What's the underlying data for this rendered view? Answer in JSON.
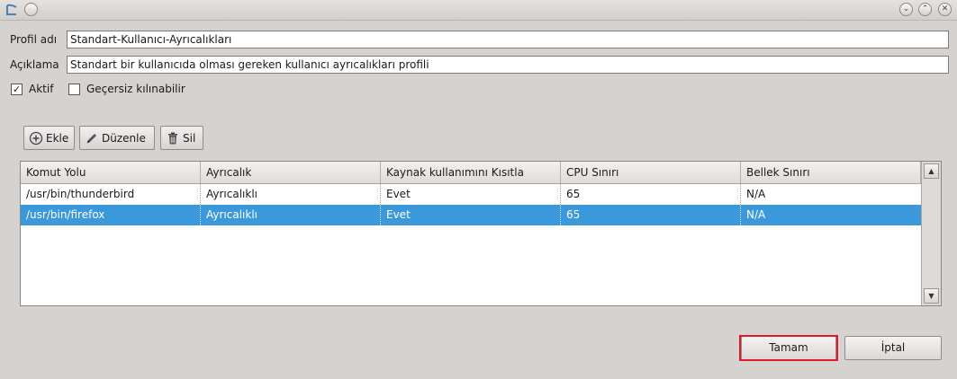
{
  "titlebar": {
    "app_icon": "app-logo-icon",
    "buttons": [
      "minimize-icon",
      "maximize-icon",
      "close-icon"
    ]
  },
  "form": {
    "profile_name_label": "Profil adı",
    "profile_name_value": "Standart-Kullanıcı-Ayrıcalıkları",
    "description_label": "Açıklama",
    "description_value": "Standart bir kullanıcıda olması gereken kullanıcı ayrıcalıkları profili",
    "active_label": "Aktif",
    "active_checked": true,
    "overridable_label": "Geçersiz kılınabilir",
    "overridable_checked": false
  },
  "toolbar": {
    "add_label": "Ekle",
    "edit_label": "Düzenle",
    "delete_label": "Sil"
  },
  "table": {
    "columns": [
      "Komut Yolu",
      "Ayrıcalık",
      "Kaynak kullanımını Kısıtla",
      "CPU Sınırı",
      "Bellek Sınırı"
    ],
    "rows": [
      [
        "/usr/bin/thunderbird",
        "Ayrıcalıklı",
        "Evet",
        "65",
        "N/A"
      ],
      [
        "/usr/bin/firefox",
        "Ayrıcalıklı",
        "Evet",
        "65",
        "N/A"
      ]
    ],
    "selected_row": 1
  },
  "dialog": {
    "ok_label": "Tamam",
    "cancel_label": "İptal"
  },
  "colors": {
    "selection": "#3b99db",
    "highlight_border": "#e0182c"
  }
}
